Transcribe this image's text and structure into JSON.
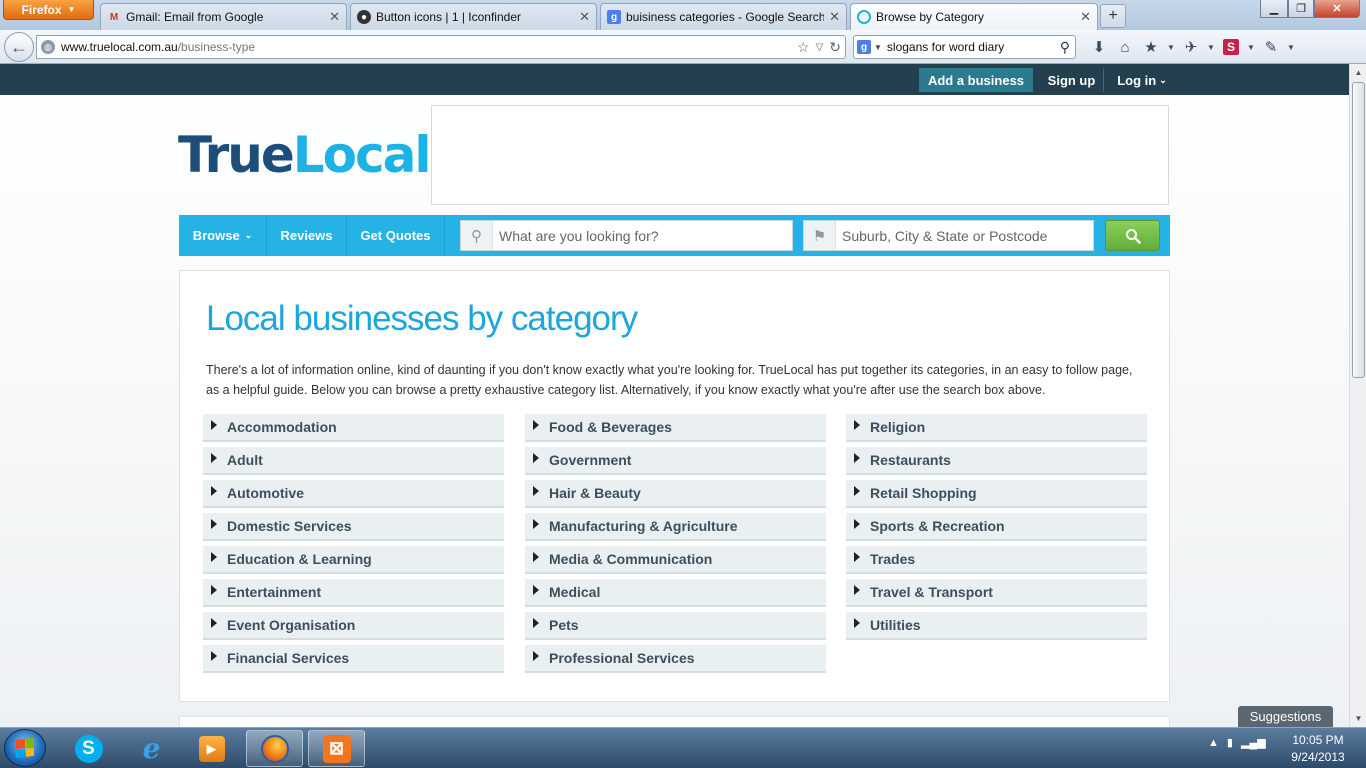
{
  "browser": {
    "menu_label": "Firefox",
    "tabs": [
      {
        "title": "Gmail: Email from Google"
      },
      {
        "title": "Button icons | 1 | Iconfinder"
      },
      {
        "title": "buisiness categories - Google Search"
      },
      {
        "title": "Browse by Category"
      }
    ],
    "url_host": "www.truelocal.com.au",
    "url_path": "/business-type",
    "search_query": "slogans for word diary"
  },
  "site": {
    "top_links": {
      "add_business": "Add a business",
      "sign_up": "Sign up",
      "log_in": "Log in"
    },
    "logo": {
      "part1": "True",
      "part2": "Local"
    },
    "nav": {
      "browse": "Browse",
      "reviews": "Reviews",
      "get_quotes": "Get Quotes"
    },
    "search": {
      "what_placeholder": "What are you looking for?",
      "where_placeholder": "Suburb, City & State or Postcode"
    },
    "heading": "Local businesses by category",
    "intro": "There's a lot of information online, kind of daunting if you don't know exactly what you're looking for. TrueLocal has put together its categories, in an easy to follow page, as a helpful guide. Below you can browse a pretty exhaustive category list. Alternatively, if you know exactly what you're after use the search box above.",
    "categories": {
      "col1": [
        "Accommodation",
        "Adult",
        "Automotive",
        "Domestic Services",
        "Education & Learning",
        "Entertainment",
        "Event Organisation",
        "Financial Services"
      ],
      "col2": [
        "Food & Beverages",
        "Government",
        "Hair & Beauty",
        "Manufacturing & Agriculture",
        "Media & Communication",
        "Medical",
        "Pets",
        "Professional Services"
      ],
      "col3": [
        "Religion",
        "Restaurants",
        "Retail Shopping",
        "Sports & Recreation",
        "Trades",
        "Travel & Transport",
        "Utilities"
      ]
    },
    "suggestions_label": "Suggestions"
  },
  "taskbar": {
    "time": "10:05 PM",
    "date": "9/24/2013"
  },
  "colors": {
    "brand_dark": "#1d4e7a",
    "brand_light": "#1cb2e6",
    "nav_blue": "#25b2e5",
    "search_green": "#62ad3a",
    "top_strip": "#243f4d"
  }
}
